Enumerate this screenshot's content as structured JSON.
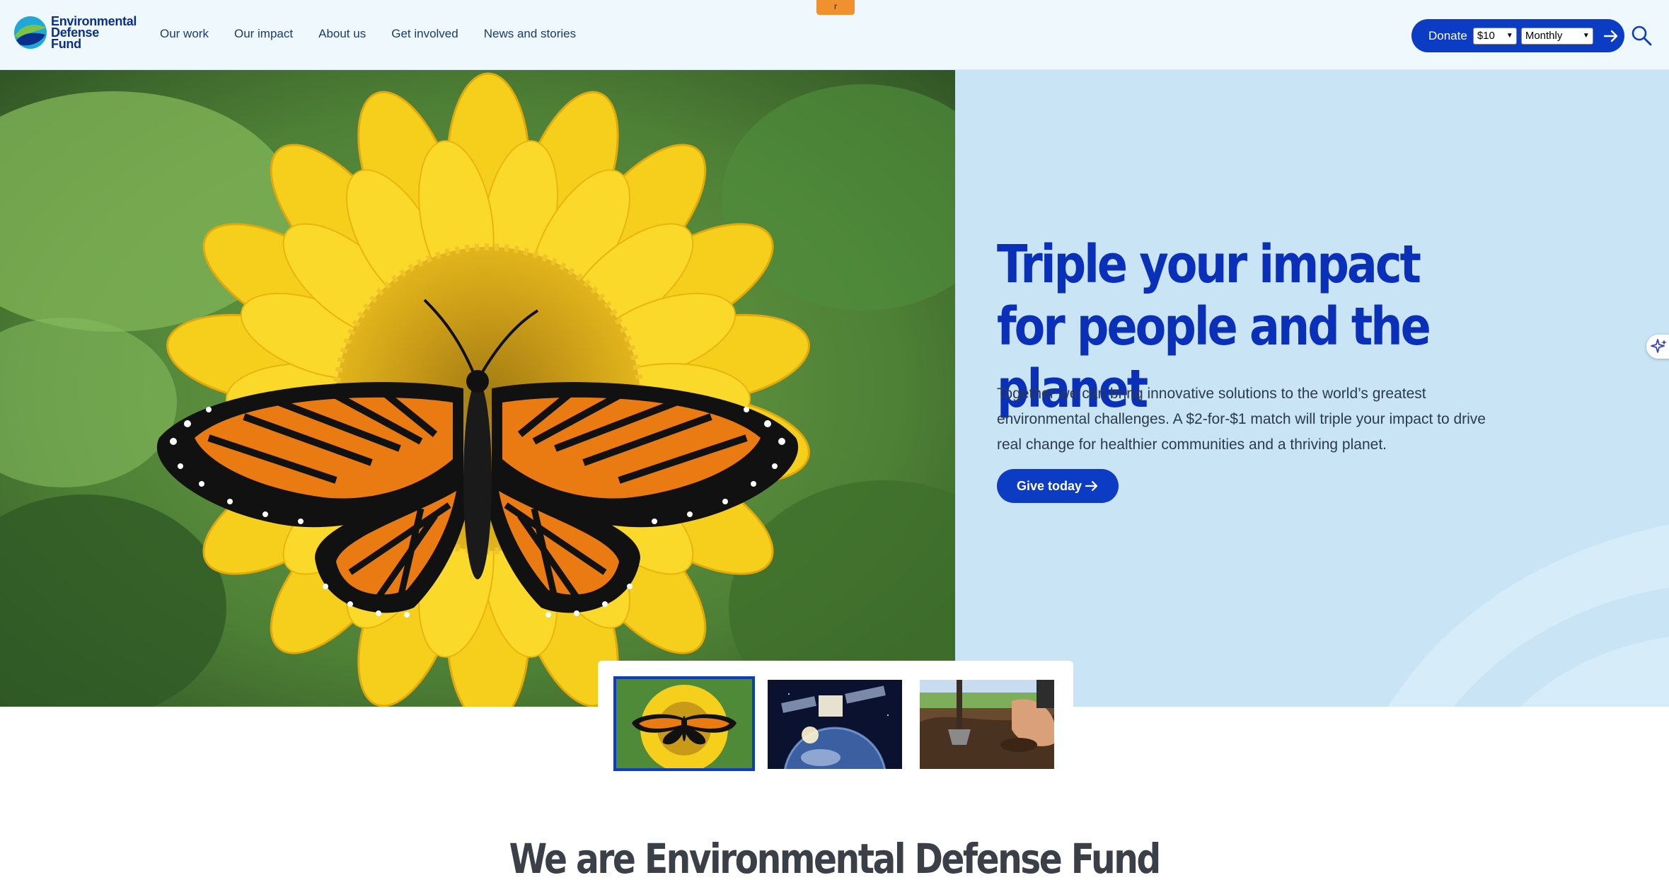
{
  "header": {
    "top_tab": "r",
    "logo": {
      "lines": [
        "Environmental",
        "Defense",
        "Fund"
      ]
    },
    "nav": [
      "Our work",
      "Our impact",
      "About us",
      "Get involved",
      "News and stories"
    ],
    "donate": {
      "label": "Donate",
      "amount": "$10",
      "frequency": "Monthly"
    }
  },
  "hero": {
    "title": "Triple your impact for people and the planet",
    "body": "Together we can bring innovative solutions to the world’s greatest environmental challenges. A $2-for-$1 match will triple your impact to drive real change for healthier communities and a thriving planet.",
    "cta": "Give today"
  },
  "carousel": {
    "active_index": 0,
    "count": 3
  },
  "section": {
    "heading": "We are Environmental Defense Fund"
  },
  "colors": {
    "brand_blue": "#0c3cc4",
    "panel": "#c8e4f5",
    "header_bg": "#eef8fd"
  }
}
